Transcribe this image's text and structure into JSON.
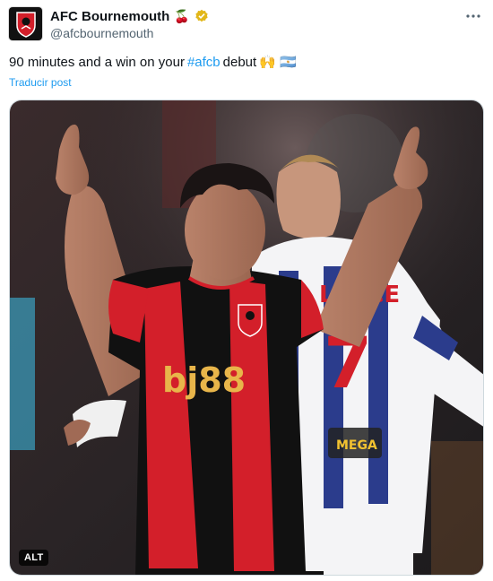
{
  "account": {
    "name": "AFC Bournemouth",
    "handle": "@afcbournemouth",
    "name_emoji": "🍒",
    "verified_color": "#e2b719"
  },
  "tweet": {
    "text_before": "90 minutes and a win on your",
    "hashtag": "#afcb",
    "text_after": "debut",
    "emojis": "🙌 🇦🇷",
    "translate_label": "Traducir post"
  },
  "media": {
    "alt_label": "ALT",
    "shirt_sponsor": "bj88",
    "opponent_name": "LLACE",
    "opponent_number": "7",
    "opponent_sponsor": "MEGA"
  },
  "icons": {
    "more": "more-options-icon",
    "verified": "verified-badge-icon"
  },
  "colors": {
    "link": "#1d9bf0",
    "secondary_text": "#536471",
    "bournemouth_red": "#d31f2a",
    "bournemouth_black": "#111111"
  }
}
